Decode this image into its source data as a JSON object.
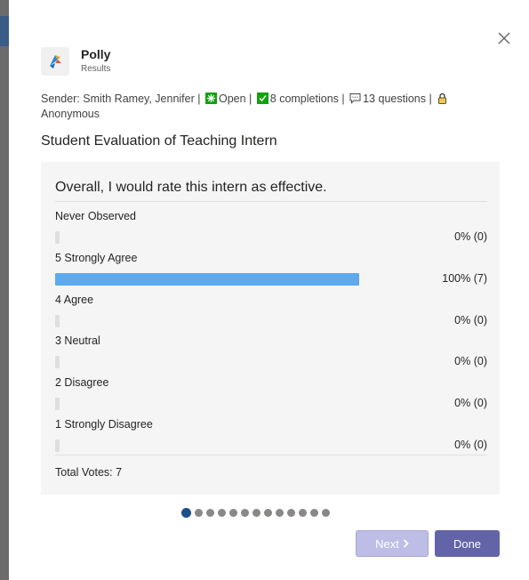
{
  "app": {
    "name": "Polly",
    "subtitle": "Results"
  },
  "meta": {
    "sender": "Sender: Smith Ramey, Jennifer |",
    "status": "Open |",
    "completions": "8 completions |",
    "questions": "13 questions |",
    "privacy": "Anonymous"
  },
  "survey": {
    "title": "Student Evaluation of Teaching Intern"
  },
  "card": {
    "question": "Overall, I would rate this intern as effective.",
    "options": [
      {
        "label": "Never Observed",
        "percent": 0,
        "display": "0% (0)"
      },
      {
        "label": "5 Strongly Agree",
        "percent": 100,
        "display": "100% (7)"
      },
      {
        "label": "4 Agree",
        "percent": 0,
        "display": "0% (0)"
      },
      {
        "label": "3 Neutral",
        "percent": 0,
        "display": "0% (0)"
      },
      {
        "label": "2 Disagree",
        "percent": 0,
        "display": "0% (0)"
      },
      {
        "label": "1 Strongly Disagree",
        "percent": 0,
        "display": "0% (0)"
      }
    ],
    "total": "Total Votes: 7"
  },
  "pagination": {
    "pages": 13,
    "current": 1
  },
  "buttons": {
    "next": "Next",
    "done": "Done"
  },
  "colors": {
    "bar": "#5ea9ec",
    "primary": "#6264a7",
    "status_open": "#13a10e",
    "completions_check": "#13a10e",
    "lock": "#f7c948"
  },
  "icons": [
    "close-icon",
    "polly-logo-icon",
    "open-status-icon",
    "check-icon",
    "comment-icon",
    "lock-icon",
    "chevron-right-icon"
  ]
}
